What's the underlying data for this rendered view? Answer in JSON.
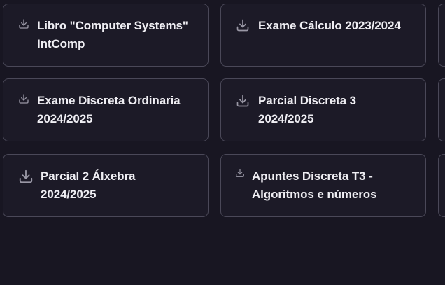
{
  "cards": [
    {
      "title": "Libro \"Computer Systems\"\nIntComp",
      "icon": "download-icon"
    },
    {
      "title": "Exame Cálculo 2023/2024",
      "icon": "download-icon"
    },
    {
      "title": "Exame Discreta Ordinaria\n2024/2025",
      "icon": "download-icon"
    },
    {
      "title": "Parcial Discreta 3\n2024/2025",
      "icon": "download-icon"
    },
    {
      "title": "Parcial 2 Álxebra\n2024/2025",
      "icon": "download-icon"
    },
    {
      "title": "Apuntes Discreta T3 -\nAlgoritmos e números",
      "icon": "download-icon"
    }
  ],
  "colors": {
    "background": "#181622",
    "card_background": "#1c1a27",
    "card_border": "#4a4858",
    "text": "#efeef3",
    "icon": "#9a98a6"
  }
}
